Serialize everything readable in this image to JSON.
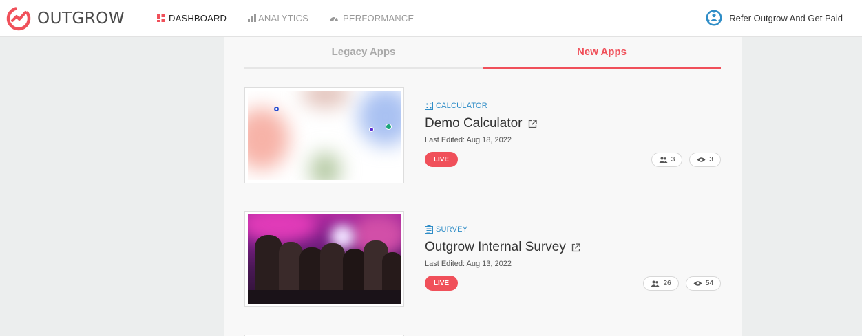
{
  "header": {
    "logo_text": "OUTGROW",
    "nav": [
      {
        "label": "DASHBOARD",
        "icon": "dashboard-icon",
        "active": true
      },
      {
        "label": "ANALYTICS",
        "icon": "bar-chart-icon",
        "active": false
      },
      {
        "label": "PERFORMANCE",
        "icon": "gauge-icon",
        "active": false
      }
    ],
    "refer_label": "Refer Outgrow And Get Paid"
  },
  "tabs": [
    {
      "label": "Legacy Apps",
      "active": false
    },
    {
      "label": "New Apps",
      "active": true
    }
  ],
  "apps": [
    {
      "type": "CALCULATOR",
      "title": "Demo Calculator",
      "last_edited": "Last Edited: Aug 18, 2022",
      "status": "LIVE",
      "users": "3",
      "views": "3"
    },
    {
      "type": "SURVEY",
      "title": "Outgrow Internal Survey",
      "last_edited": "Last Edited: Aug 13, 2022",
      "status": "LIVE",
      "users": "26",
      "views": "54"
    }
  ],
  "colors": {
    "accent": "#f0505a",
    "type_blue": "#2f8dc7"
  }
}
